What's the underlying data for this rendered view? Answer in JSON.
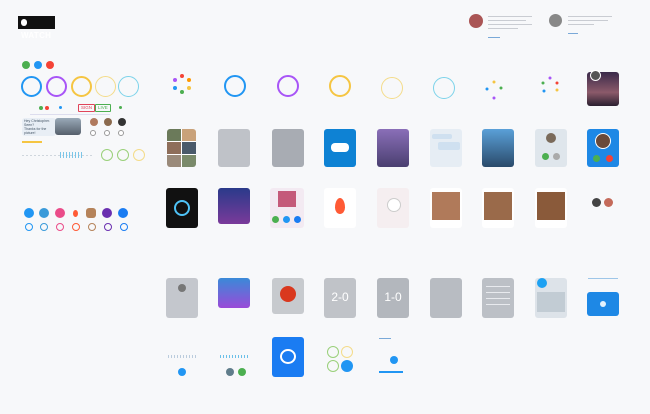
{
  "brand": {
    "logo_text": "WATCH"
  },
  "tags": {
    "first": "SIGN",
    "second": "LIVE"
  },
  "numbers": {
    "score_a": "2-0",
    "score_b": "1-0"
  },
  "chat": {
    "bubble_1": "Hey Christopher. Seen?",
    "bubble_2": "Thanks for the picture!"
  },
  "colors": {
    "blue": "#2196f3",
    "green": "#4caf50",
    "red": "#f44336",
    "purple": "#a855f7",
    "yellow": "#f5c542",
    "skype": "#00aff0",
    "messenger": "#0084ff",
    "tinder": "#ff5a35",
    "cyan": "#7cd3ea"
  },
  "icons": [
    "apple-icon",
    "phone-icon",
    "mic-icon",
    "close-icon",
    "skype-icon",
    "messenger-icon",
    "tinder-flame-icon",
    "shazam-icon",
    "twitter-icon",
    "folder-icon"
  ]
}
